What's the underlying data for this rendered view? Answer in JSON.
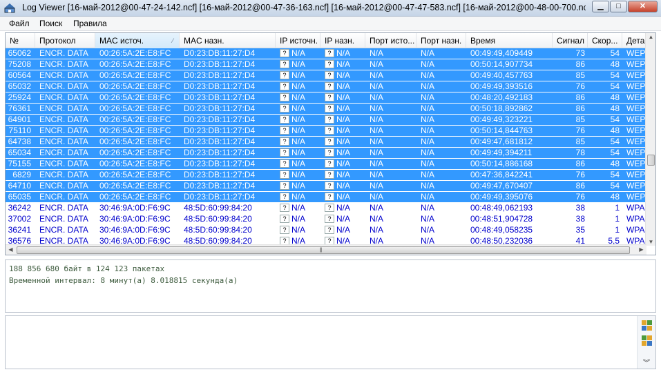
{
  "window": {
    "title": "Log Viewer [16-май-2012@00-47-24-142.ncf] [16-май-2012@00-47-36-163.ncf] [16-май-2012@00-47-47-583.ncf] [16-май-2012@00-48-00-700.ncf] [...",
    "buttons": {
      "minimize": "▁",
      "maximize": "□",
      "close": "✕"
    }
  },
  "menu": [
    "Файл",
    "Поиск",
    "Правила"
  ],
  "table": {
    "columns": [
      "№",
      "Протокол",
      "MAC источ.",
      "MAC назн.",
      "IP источн.",
      "IP назн.",
      "Порт исто...",
      "Порт назн.",
      "Время",
      "Сигнал",
      "Скор...",
      "Дета"
    ],
    "sorted_column": "MAC источ.",
    "rows": [
      {
        "sel": true,
        "n": "65062",
        "proto": "ENCR. DATA",
        "src": "00:26:5A:2E:E8:FC",
        "dst": "D0:23:DB:11:27:D4",
        "ips": "N/A",
        "ipd": "N/A",
        "ps": "N/A",
        "pd": "N/A",
        "time": "00:49:49,409449",
        "sig": "73",
        "spd": "54",
        "det": "WEP"
      },
      {
        "sel": true,
        "n": "75208",
        "proto": "ENCR. DATA",
        "src": "00:26:5A:2E:E8:FC",
        "dst": "D0:23:DB:11:27:D4",
        "ips": "N/A",
        "ipd": "N/A",
        "ps": "N/A",
        "pd": "N/A",
        "time": "00:50:14,907734",
        "sig": "86",
        "spd": "48",
        "det": "WEP"
      },
      {
        "sel": true,
        "n": "60564",
        "proto": "ENCR. DATA",
        "src": "00:26:5A:2E:E8:FC",
        "dst": "D0:23:DB:11:27:D4",
        "ips": "N/A",
        "ipd": "N/A",
        "ps": "N/A",
        "pd": "N/A",
        "time": "00:49:40,457763",
        "sig": "85",
        "spd": "54",
        "det": "WEP"
      },
      {
        "sel": true,
        "n": "65032",
        "proto": "ENCR. DATA",
        "src": "00:26:5A:2E:E8:FC",
        "dst": "D0:23:DB:11:27:D4",
        "ips": "N/A",
        "ipd": "N/A",
        "ps": "N/A",
        "pd": "N/A",
        "time": "00:49:49,393516",
        "sig": "76",
        "spd": "54",
        "det": "WEP"
      },
      {
        "sel": true,
        "n": "25924",
        "proto": "ENCR. DATA",
        "src": "00:26:5A:2E:E8:FC",
        "dst": "D0:23:DB:11:27:D4",
        "ips": "N/A",
        "ipd": "N/A",
        "ps": "N/A",
        "pd": "N/A",
        "time": "00:48:20,492183",
        "sig": "86",
        "spd": "48",
        "det": "WEP"
      },
      {
        "sel": true,
        "n": "76361",
        "proto": "ENCR. DATA",
        "src": "00:26:5A:2E:E8:FC",
        "dst": "D0:23:DB:11:27:D4",
        "ips": "N/A",
        "ipd": "N/A",
        "ps": "N/A",
        "pd": "N/A",
        "time": "00:50:18,892862",
        "sig": "86",
        "spd": "48",
        "det": "WEP"
      },
      {
        "sel": true,
        "n": "64901",
        "proto": "ENCR. DATA",
        "src": "00:26:5A:2E:E8:FC",
        "dst": "D0:23:DB:11:27:D4",
        "ips": "N/A",
        "ipd": "N/A",
        "ps": "N/A",
        "pd": "N/A",
        "time": "00:49:49,323221",
        "sig": "85",
        "spd": "54",
        "det": "WEP"
      },
      {
        "sel": true,
        "n": "75110",
        "proto": "ENCR. DATA",
        "src": "00:26:5A:2E:E8:FC",
        "dst": "D0:23:DB:11:27:D4",
        "ips": "N/A",
        "ipd": "N/A",
        "ps": "N/A",
        "pd": "N/A",
        "time": "00:50:14,844763",
        "sig": "76",
        "spd": "48",
        "det": "WEP"
      },
      {
        "sel": true,
        "n": "64738",
        "proto": "ENCR. DATA",
        "src": "00:26:5A:2E:E8:FC",
        "dst": "D0:23:DB:11:27:D4",
        "ips": "N/A",
        "ipd": "N/A",
        "ps": "N/A",
        "pd": "N/A",
        "time": "00:49:47,681812",
        "sig": "85",
        "spd": "54",
        "det": "WEP"
      },
      {
        "sel": true,
        "n": "65034",
        "proto": "ENCR. DATA",
        "src": "00:26:5A:2E:E8:FC",
        "dst": "D0:23:DB:11:27:D4",
        "ips": "N/A",
        "ipd": "N/A",
        "ps": "N/A",
        "pd": "N/A",
        "time": "00:49:49,394211",
        "sig": "78",
        "spd": "54",
        "det": "WEP"
      },
      {
        "sel": true,
        "n": "75155",
        "proto": "ENCR. DATA",
        "src": "00:26:5A:2E:E8:FC",
        "dst": "D0:23:DB:11:27:D4",
        "ips": "N/A",
        "ipd": "N/A",
        "ps": "N/A",
        "pd": "N/A",
        "time": "00:50:14,886168",
        "sig": "86",
        "spd": "48",
        "det": "WEP"
      },
      {
        "sel": true,
        "n": "6829",
        "proto": "ENCR. DATA",
        "src": "00:26:5A:2E:E8:FC",
        "dst": "D0:23:DB:11:27:D4",
        "ips": "N/A",
        "ipd": "N/A",
        "ps": "N/A",
        "pd": "N/A",
        "time": "00:47:36,842241",
        "sig": "76",
        "spd": "54",
        "det": "WEP"
      },
      {
        "sel": true,
        "n": "64710",
        "proto": "ENCR. DATA",
        "src": "00:26:5A:2E:E8:FC",
        "dst": "D0:23:DB:11:27:D4",
        "ips": "N/A",
        "ipd": "N/A",
        "ps": "N/A",
        "pd": "N/A",
        "time": "00:49:47,670407",
        "sig": "86",
        "spd": "54",
        "det": "WEP"
      },
      {
        "sel": true,
        "n": "65035",
        "proto": "ENCR. DATA",
        "src": "00:26:5A:2E:E8:FC",
        "dst": "D0:23:DB:11:27:D4",
        "ips": "N/A",
        "ipd": "N/A",
        "ps": "N/A",
        "pd": "N/A",
        "time": "00:49:49,395076",
        "sig": "76",
        "spd": "48",
        "det": "WEP"
      },
      {
        "sel": false,
        "n": "36242",
        "proto": "ENCR. DATA",
        "src": "30:46:9A:0D:F6:9C",
        "dst": "48:5D:60:99:84:20",
        "ips": "N/A",
        "ipd": "N/A",
        "ps": "N/A",
        "pd": "N/A",
        "time": "00:48:49,062193",
        "sig": "38",
        "spd": "1",
        "det": "WPA"
      },
      {
        "sel": false,
        "n": "37002",
        "proto": "ENCR. DATA",
        "src": "30:46:9A:0D:F6:9C",
        "dst": "48:5D:60:99:84:20",
        "ips": "N/A",
        "ipd": "N/A",
        "ps": "N/A",
        "pd": "N/A",
        "time": "00:48:51,904728",
        "sig": "38",
        "spd": "1",
        "det": "WPA"
      },
      {
        "sel": false,
        "n": "36241",
        "proto": "ENCR. DATA",
        "src": "30:46:9A:0D:F6:9C",
        "dst": "48:5D:60:99:84:20",
        "ips": "N/A",
        "ipd": "N/A",
        "ps": "N/A",
        "pd": "N/A",
        "time": "00:48:49,058235",
        "sig": "35",
        "spd": "1",
        "det": "WPA"
      },
      {
        "sel": false,
        "n": "36576",
        "proto": "ENCR. DATA",
        "src": "30:46:9A:0D:F6:9C",
        "dst": "48:5D:60:99:84:20",
        "ips": "N/A",
        "ipd": "N/A",
        "ps": "N/A",
        "pd": "N/A",
        "time": "00:48:50,232036",
        "sig": "41",
        "spd": "5,5",
        "det": "WPA"
      }
    ]
  },
  "stats": {
    "line1": "188 856 680 байт в 124 123 пакетах",
    "line2": "Временной интервал: 8 минут(а) 8.018815 секунда(а)"
  },
  "colors": {
    "selection": "#3399ff",
    "row_text": "#0000cc",
    "stats_text": "#3c5a3c"
  }
}
